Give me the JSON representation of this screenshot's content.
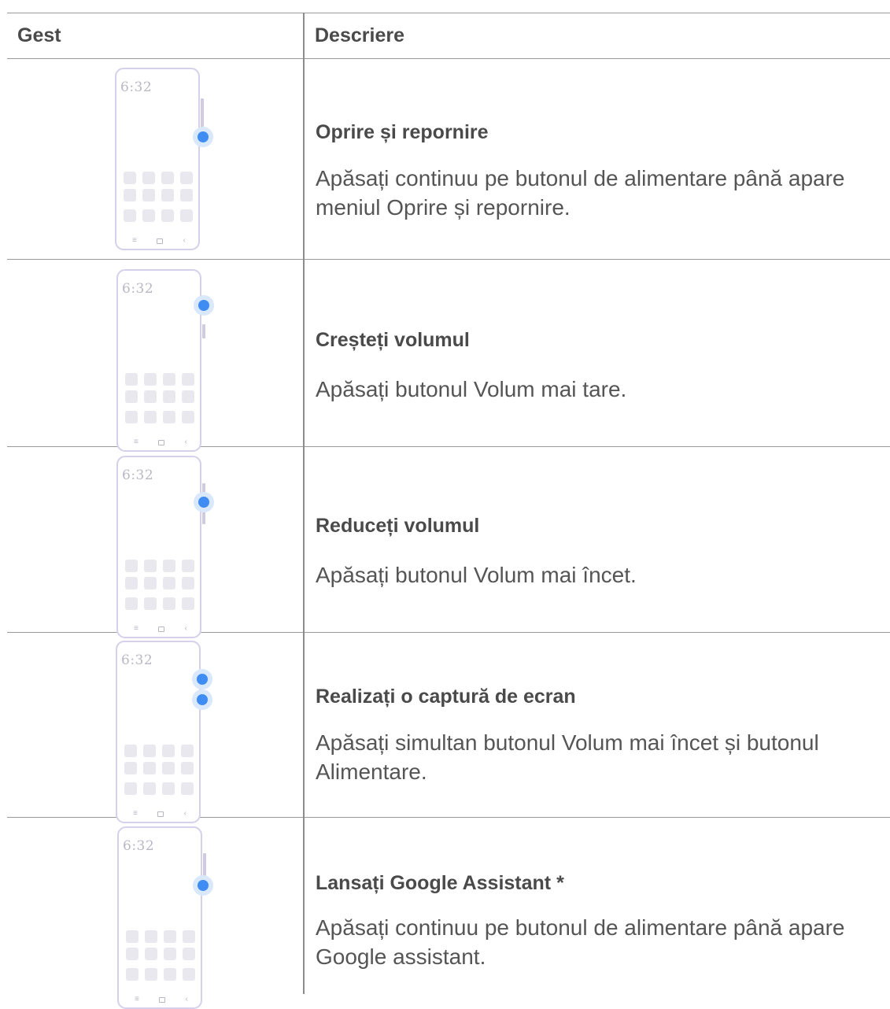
{
  "header": {
    "col1": "Gest",
    "col2": "Descriere"
  },
  "phone_time": "6:32",
  "accent_color": "#3f8cf2",
  "rows": [
    {
      "title": "Oprire și repornire",
      "description": "Apăsați continuu pe butonul de alimentare până apare meniul Oprire și repornire."
    },
    {
      "title": "Creșteți volumul",
      "description": "Apăsați butonul Volum mai tare."
    },
    {
      "title": "Reduceți volumul",
      "description": "Apăsați butonul Volum mai încet."
    },
    {
      "title": "Realizați o captură de ecran",
      "description": "Apăsați simultan butonul Volum mai încet și butonul Alimentare."
    },
    {
      "title": "Lansați Google Assistant *",
      "description": "Apăsați continuu pe butonul de alimentare până apare Google assistant."
    }
  ]
}
